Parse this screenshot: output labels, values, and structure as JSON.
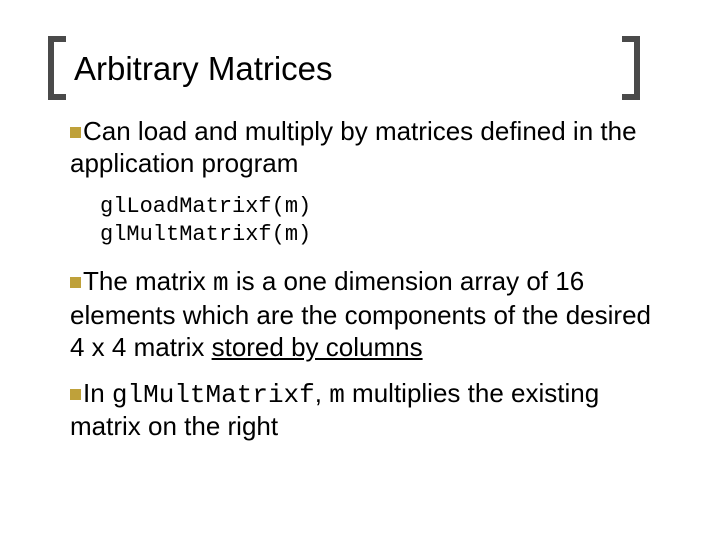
{
  "title": "Arbitrary Matrices",
  "bullets": {
    "b1": "Can load and multiply by matrices defined in the application program",
    "b2a": "The matrix ",
    "b2b": " is a one dimension array of 16 elements which are the components of the desired 4 x 4 matrix ",
    "b2c": "stored by columns",
    "b3a": "In ",
    "b3b": ", ",
    "b3c": " multiplies the existing matrix on the right"
  },
  "code": {
    "line1": "glLoadMatrixf(m)",
    "line2": "glMultMatrixf(m)",
    "m": "m",
    "mult": "glMultMatrixf"
  }
}
